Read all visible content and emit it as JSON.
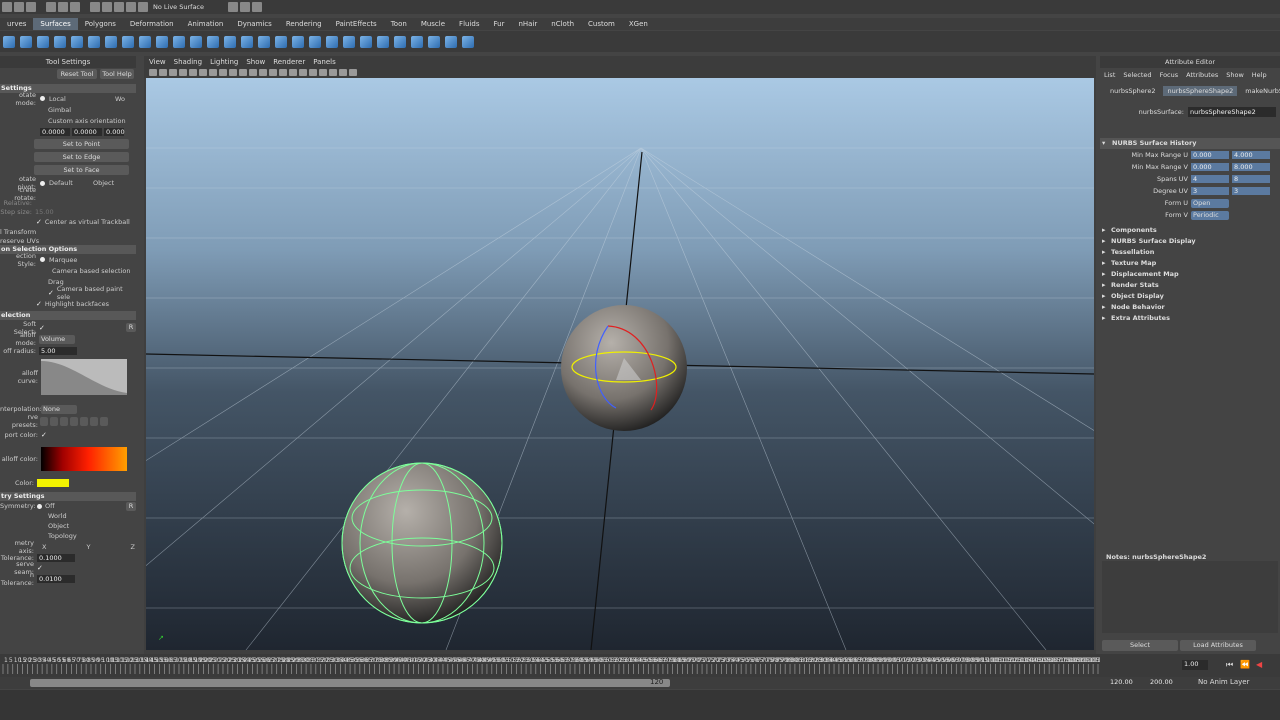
{
  "statusline": {
    "live_surface": "No Live Surface"
  },
  "shelf": {
    "tabs": [
      "urves",
      "Surfaces",
      "Polygons",
      "Deformation",
      "Animation",
      "Dynamics",
      "Rendering",
      "PaintEffects",
      "Toon",
      "Muscle",
      "Fluids",
      "Fur",
      "nHair",
      "nCloth",
      "Custom",
      "XGen"
    ],
    "active_tab": "Surfaces"
  },
  "tool_settings": {
    "title": "Tool Settings",
    "reset_button": "Reset Tool",
    "help_button": "Tool Help",
    "settings_header": "Settings",
    "rotate_mode_label": "otate mode:",
    "rotate_mode_local": "Local",
    "rotate_mode_world": "Wo",
    "gimbal": "Gimbal",
    "custom_axis": "Custom axis orientation",
    "axis_values": [
      "0.0000",
      "0.0000",
      "0.000"
    ],
    "set_to_point": "Set to Point",
    "set_to_edge": "Set to Edge",
    "set_to_face": "Set to Face",
    "rotate_pivot_label": "otate pivot:",
    "pivot_default": "Default",
    "pivot_object": "Object",
    "discrete_rotate_label": "crete rotate:",
    "relative_label": "Relative:",
    "step_size_label": "Step size:",
    "step_size_value": "15.00",
    "center_trackball": "Center as virtual Trackball",
    "transform_label": "l Transform",
    "preserve_uvs_label": "reserve UVs",
    "selection_options_header": "on Selection Options",
    "selection_style_label": "ection Style:",
    "marquee": "Marquee",
    "camera_based_selection": "Camera based selection",
    "drag": "Drag",
    "camera_based_paint": "Camera based paint sele",
    "highlight_backfaces": "Highlight backfaces",
    "selection_header": "election",
    "soft_select_label": "Soft Select:",
    "soft_select_reset": "R",
    "falloff_mode_label": "alloff mode:",
    "falloff_mode_value": "Volume",
    "falloff_radius_label": "off radius:",
    "falloff_radius_value": "5.00",
    "falloff_curve_label": "alloff curve:",
    "interpolation_label": "nterpolation:",
    "interpolation_value": "None",
    "curve_presets_label": "rve presets:",
    "viewport_color_label": "port color:",
    "falloff_color_label": "alloff color:",
    "color_label": "Color:",
    "symmetry_header": "try Settings",
    "symmetry_label": "Symmetry:",
    "symmetry_off": "Off",
    "symmetry_world": "World",
    "symmetry_object": "Object",
    "symmetry_topology": "Topology",
    "symmetry_reset": "R",
    "symmetry_axis_label": "metry axis:",
    "axis_x": "X",
    "axis_y": "Y",
    "axis_z": "Z",
    "tolerance_label": "Tolerance:",
    "tolerance_value": "0.1000",
    "preserve_seam_label": "serve seam:",
    "seam_tolerance_label": "n Tolerance:",
    "seam_tolerance_value": "0.0100"
  },
  "viewport": {
    "menu": [
      "View",
      "Shading",
      "Lighting",
      "Show",
      "Renderer",
      "Panels"
    ]
  },
  "attribute_editor": {
    "title": "Attribute Editor",
    "menu": [
      "List",
      "Selected",
      "Focus",
      "Attributes",
      "Show",
      "Help"
    ],
    "tabs": [
      "nurbsSphere2",
      "nurbsSphereShape2",
      "makeNurbSphe"
    ],
    "active_tab": "nurbsSphereShape2",
    "node_label": "nurbsSurface:",
    "node_value": "nurbsSphereShape2",
    "history_header": "NURBS Surface History",
    "min_max_u_label": "Min Max Range U",
    "min_max_u": [
      "0.000",
      "4.000"
    ],
    "min_max_v_label": "Min Max Range V",
    "min_max_v": [
      "0.000",
      "8.000"
    ],
    "spans_uv_label": "Spans UV",
    "spans_uv": [
      "4",
      "8"
    ],
    "degree_uv_label": "Degree UV",
    "degree_uv": [
      "3",
      "3"
    ],
    "form_u_label": "Form U",
    "form_u_value": "Open",
    "form_v_label": "Form V",
    "form_v_value": "Periodic",
    "sections": [
      "Components",
      "NURBS Surface Display",
      "Tessellation",
      "Texture Map",
      "Displacement Map",
      "Render Stats",
      "Object Display",
      "Node Behavior",
      "Extra Attributes"
    ],
    "notes_label": "Notes:  nurbsSphereShape2",
    "select_button": "Select",
    "load_attributes_button": "Load Attributes"
  },
  "timeline": {
    "ticks": [
      "1",
      "5",
      "10",
      "15",
      "20",
      "25",
      "30",
      "35",
      "40",
      "45",
      "50",
      "55",
      "60",
      "65",
      "70",
      "75",
      "80",
      "85",
      "90",
      "95",
      "100",
      "105",
      "110",
      "115",
      "120",
      "125",
      "130",
      "135",
      "140",
      "145",
      "150",
      "155",
      "160",
      "165",
      "170",
      "175",
      "180",
      "185",
      "190",
      "195",
      "200",
      "205",
      "210",
      "215",
      "220",
      "225",
      "230",
      "235",
      "240",
      "245",
      "250",
      "255",
      "260",
      "265",
      "270",
      "275",
      "280",
      "285",
      "290",
      "295",
      "300",
      "305",
      "310",
      "315",
      "320",
      "325",
      "330",
      "335",
      "340",
      "345",
      "350",
      "355",
      "360",
      "365",
      "370",
      "375",
      "380",
      "385",
      "390",
      "395",
      "400",
      "405",
      "410",
      "415",
      "420",
      "425",
      "430",
      "435",
      "440",
      "445",
      "450",
      "455",
      "460",
      "465",
      "470",
      "475",
      "480",
      "485",
      "490",
      "495",
      "500",
      "505",
      "510",
      "515",
      "520",
      "525",
      "530",
      "535",
      "540",
      "545",
      "550",
      "555",
      "560",
      "565",
      "570",
      "575",
      "580",
      "585",
      "590",
      "595",
      "600",
      "605",
      "610",
      "615",
      "620",
      "625",
      "630",
      "635",
      "640",
      "645",
      "650",
      "655",
      "660",
      "665",
      "670",
      "675",
      "680",
      "685",
      "690",
      "695",
      "700",
      "705",
      "710",
      "715",
      "720",
      "725",
      "730",
      "735",
      "740",
      "745",
      "750",
      "755",
      "760",
      "765",
      "770",
      "775",
      "780",
      "785",
      "790",
      "795",
      "800",
      "805",
      "810",
      "815",
      "820",
      "825",
      "830",
      "835",
      "840",
      "845",
      "850",
      "855",
      "860",
      "865",
      "870",
      "875",
      "880",
      "885",
      "890",
      "895",
      "900",
      "905",
      "910",
      "915",
      "920",
      "925",
      "930",
      "935",
      "940",
      "945",
      "950",
      "955",
      "960",
      "965",
      "970",
      "975",
      "980",
      "985",
      "990",
      "995",
      "1000",
      "1005",
      "1010",
      "1015",
      "1020",
      "1025",
      "1030",
      "1035",
      "1040",
      "1045",
      "1050",
      "1055",
      "1060",
      "1065",
      "1070",
      "1075",
      "1080",
      "1085",
      "1090",
      "1095",
      "1100",
      "1105",
      "1110",
      "1115",
      "1120"
    ],
    "current_frame": "1.00",
    "range_start": "1",
    "range_marker": "120",
    "end_time": "120.00",
    "max_time": "200.00",
    "anim_layer": "No Anim Layer"
  },
  "colors": {
    "accent": "#5d6a78",
    "color_swatch": "#f3f300",
    "green_wire": "#7dff9a"
  }
}
